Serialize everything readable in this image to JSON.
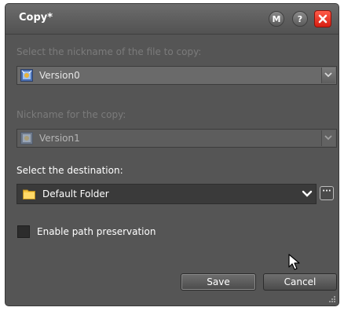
{
  "dialog": {
    "title": "Copy*",
    "title_buttons": {
      "m_label": "M",
      "help_label": "?"
    }
  },
  "source": {
    "label": "Select the nickname of the file to copy:",
    "value": "Version0",
    "disabled": true
  },
  "copy": {
    "label": "Nickname for the copy:",
    "value": "Version1",
    "disabled": true
  },
  "destination": {
    "label": "Select the destination:",
    "value": "Default Folder",
    "browse_label": "···"
  },
  "options": {
    "path_preservation_label": "Enable path preservation",
    "path_preservation_checked": false
  },
  "buttons": {
    "save": "Save",
    "cancel": "Cancel"
  },
  "colors": {
    "background": "#555555",
    "close": "#e0291b",
    "folder": "#f5c542"
  }
}
